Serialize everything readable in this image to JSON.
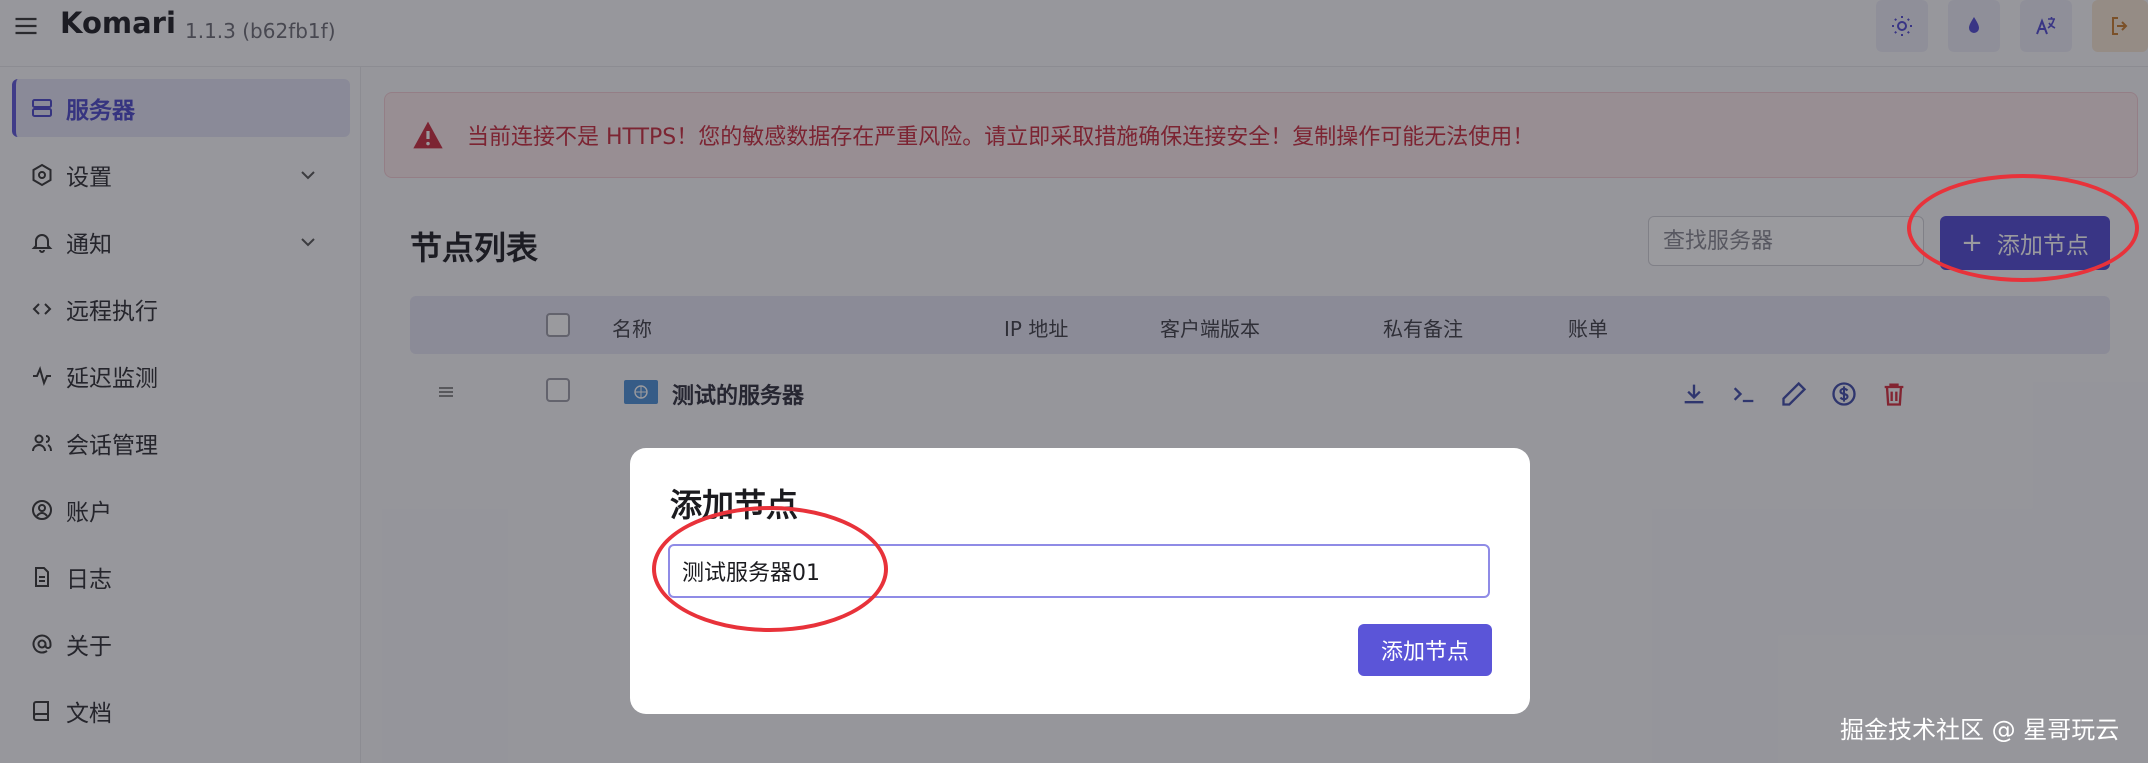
{
  "header": {
    "brand": "Komari",
    "version": "1.1.3 (b62fb1f)",
    "icons": [
      "menu-icon",
      "sun-icon",
      "droplet-icon",
      "translate-icon",
      "logout-icon"
    ]
  },
  "sidebar": {
    "items": [
      {
        "label": "服务器",
        "icon": "server-icon",
        "active": true
      },
      {
        "label": "设置",
        "icon": "settings-icon",
        "expandable": true
      },
      {
        "label": "通知",
        "icon": "bell-icon",
        "expandable": true
      },
      {
        "label": "远程执行",
        "icon": "code-icon"
      },
      {
        "label": "延迟监测",
        "icon": "activity-icon"
      },
      {
        "label": "会话管理",
        "icon": "users-icon"
      },
      {
        "label": "账户",
        "icon": "user-circle-icon"
      },
      {
        "label": "日志",
        "icon": "file-icon"
      },
      {
        "label": "关于",
        "icon": "at-icon"
      },
      {
        "label": "文档",
        "icon": "book-icon"
      }
    ]
  },
  "alert": {
    "text": "当前连接不是 HTTPS！您的敏感数据存在严重风险。请立即采取措施确保连接安全！复制操作可能无法使用！",
    "color": "#c8283b"
  },
  "main": {
    "title": "节点列表",
    "search_placeholder": "查找服务器",
    "add_button": "添加节点",
    "columns": [
      "名称",
      "IP 地址",
      "客户端版本",
      "私有备注",
      "账单"
    ],
    "rows": [
      {
        "name": "测试的服务器",
        "flag": "un-flag-icon"
      }
    ]
  },
  "modal": {
    "title": "添加节点",
    "input_value": "测试服务器01",
    "submit": "添加节点"
  },
  "watermark": "掘金技术社区 @ 星哥玩云",
  "colors": {
    "accent": "#5b55d8",
    "danger": "#c8283b",
    "annotation": "#e8323a"
  }
}
